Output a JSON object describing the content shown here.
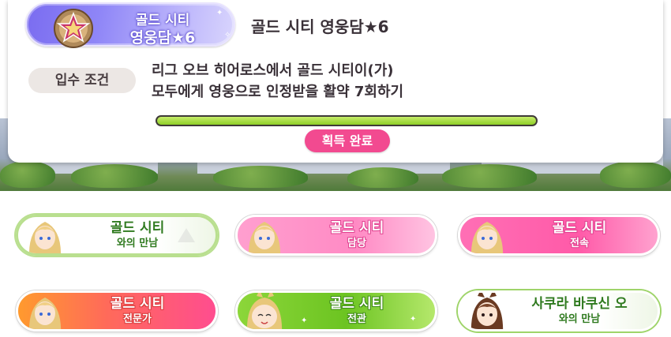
{
  "current_title": {
    "plate_line1": "골드 시티",
    "plate_line2": "영웅담★6",
    "name": "골드 시티 영웅담★6",
    "condition_label": "입수 조건",
    "condition_line1": "리그 오브 히어로스에서 골드 시티이(가)",
    "condition_line2": "모두에게 영웅으로 인정받을 활약 7회하기",
    "progress_fraction": 1.0,
    "status_badge": "획득 완료"
  },
  "colors": {
    "plate_accent": "#8f86f7",
    "badge_pink": "#f24a90",
    "progress_green": "#8fcf27"
  },
  "title_list": [
    {
      "line1": "골드 시티",
      "line2": "와의 만남",
      "style": "green-white-plate",
      "portrait": "gold-city-portrait"
    },
    {
      "line1": "골드 시티",
      "line2": "담당",
      "style": "pink-plate",
      "portrait": "gold-city-portrait"
    },
    {
      "line1": "골드 시티",
      "line2": "전속",
      "style": "dark-pink-plate",
      "portrait": "gold-city-portrait"
    },
    {
      "line1": "골드 시티",
      "line2": "전문가",
      "style": "orange-pink-plate",
      "portrait": "gold-city-portrait"
    },
    {
      "line1": "골드 시티",
      "line2": "전관",
      "style": "green-plate",
      "portrait": "gold-city-chibi-portrait"
    },
    {
      "line1": "사쿠라 바쿠신 오",
      "line2": "와의 만남",
      "style": "white-green-plate",
      "portrait": "sakura-bakushin-o-portrait"
    }
  ]
}
